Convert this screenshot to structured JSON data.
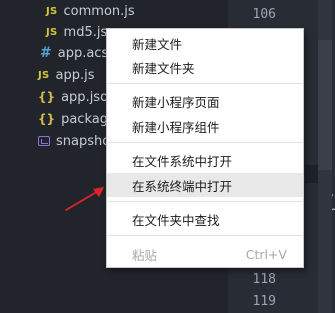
{
  "file_tree": {
    "items": [
      {
        "icon": "JS",
        "label": "common.js"
      },
      {
        "icon": "JS",
        "label": "md5.js"
      },
      {
        "icon": "#",
        "label": "app.acss"
      },
      {
        "icon": "JS",
        "label": "app.js"
      },
      {
        "icon": "{}",
        "label": "app.json"
      },
      {
        "icon": "{}",
        "label": "package-"
      },
      {
        "icon": "snapshot",
        "label": "snapshot"
      }
    ]
  },
  "gutter": {
    "lines": [
      "106",
      "118",
      "119"
    ]
  },
  "editor": {
    "fragments": [
      "},",
      "or"
    ]
  },
  "context_menu": {
    "items": [
      {
        "label": "新建文件"
      },
      {
        "label": "新建文件夹"
      },
      {
        "label": "新建小程序页面"
      },
      {
        "label": "新建小程序组件"
      },
      {
        "label": "在文件系统中打开"
      },
      {
        "label": "在系统终端中打开"
      },
      {
        "label": "在文件夹中查找"
      },
      {
        "label": "粘贴",
        "shortcut": "Ctrl+V"
      }
    ]
  },
  "colors": {
    "annotation_arrow": "#e0242b",
    "menu_hover": "#e8e8e8"
  }
}
